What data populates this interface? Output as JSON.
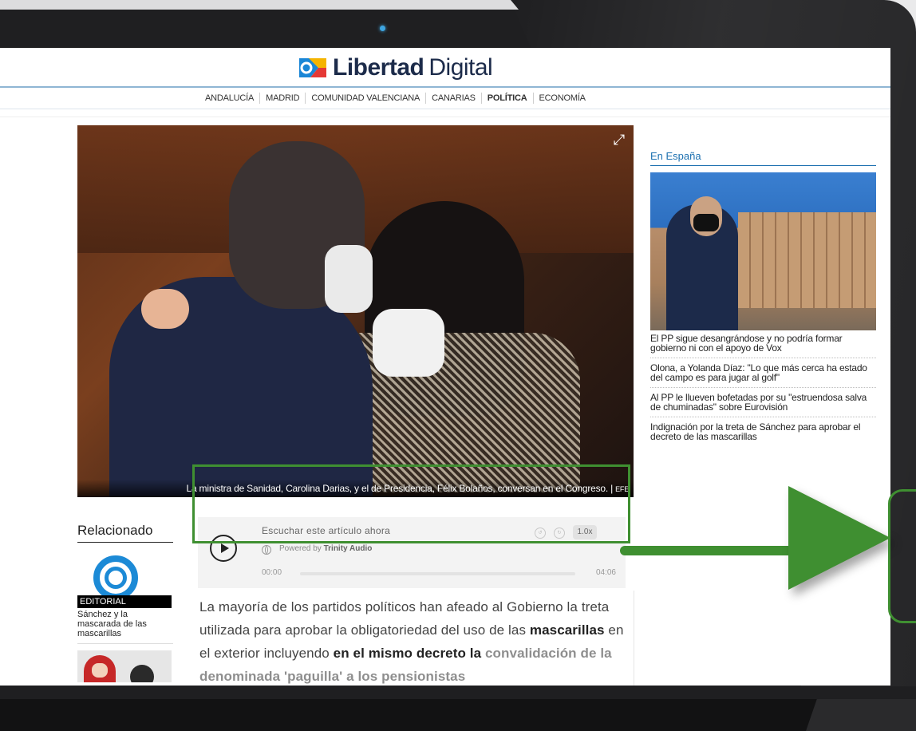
{
  "site": {
    "logo_word1": "Libertad",
    "logo_word2": "Digital",
    "brand_color": "#1c2b4a"
  },
  "nav": {
    "items": [
      "ANDALUCÍA",
      "MADRID",
      "COMUNIDAD VALENCIANA",
      "CANARIAS",
      "POLÍTICA",
      "ECONOMÍA"
    ],
    "active": "POLÍTICA"
  },
  "hero": {
    "caption": "La ministra de Sanidad, Carolina Darias, y el de Presidencia, Félix Bolaños, conversan en el Congreso. |",
    "credit": "EFE",
    "expand_icon": "expand-icon"
  },
  "sidebar": {
    "title": "En España",
    "items": [
      "El PP sigue desangrándose y no podría formar gobierno ni con el apoyo de Vox",
      "Olona, a Yolanda Díaz: \"Lo que más cerca ha estado del campo es para jugar al golf\"",
      "Al PP le llueven bofetadas por su \"estruendosa salva de chuminadas\" sobre Eurovisión",
      "Indignación por la treta de Sánchez para aprobar el decreto de las mascarillas"
    ]
  },
  "related": {
    "title": "Relacionado",
    "tag": "EDITORIAL",
    "item_text": "Sánchez y la mascarada de las mascarillas"
  },
  "player": {
    "title": "Escuchar este artículo ahora",
    "powered_prefix": "Powered by",
    "powered_brand": "Trinity Audio",
    "time_start": "00:00",
    "time_end": "04:06",
    "speed": "1.0x",
    "progress": 0
  },
  "article": {
    "p1_part1": "La mayoría de los partidos políticos han afeado al Gobierno la treta utilizada para aprobar la obligatoriedad del uso de las ",
    "p1_bold1": "mascarillas",
    "p1_part2": " en el exterior incluyendo ",
    "p1_bold2": "en el mismo decreto la",
    "p1_cut": "convalidación de la denominada 'paguilla' a los pensionistas"
  },
  "colors": {
    "accent_green": "#3f8f31",
    "link_blue": "#1c70b0"
  }
}
